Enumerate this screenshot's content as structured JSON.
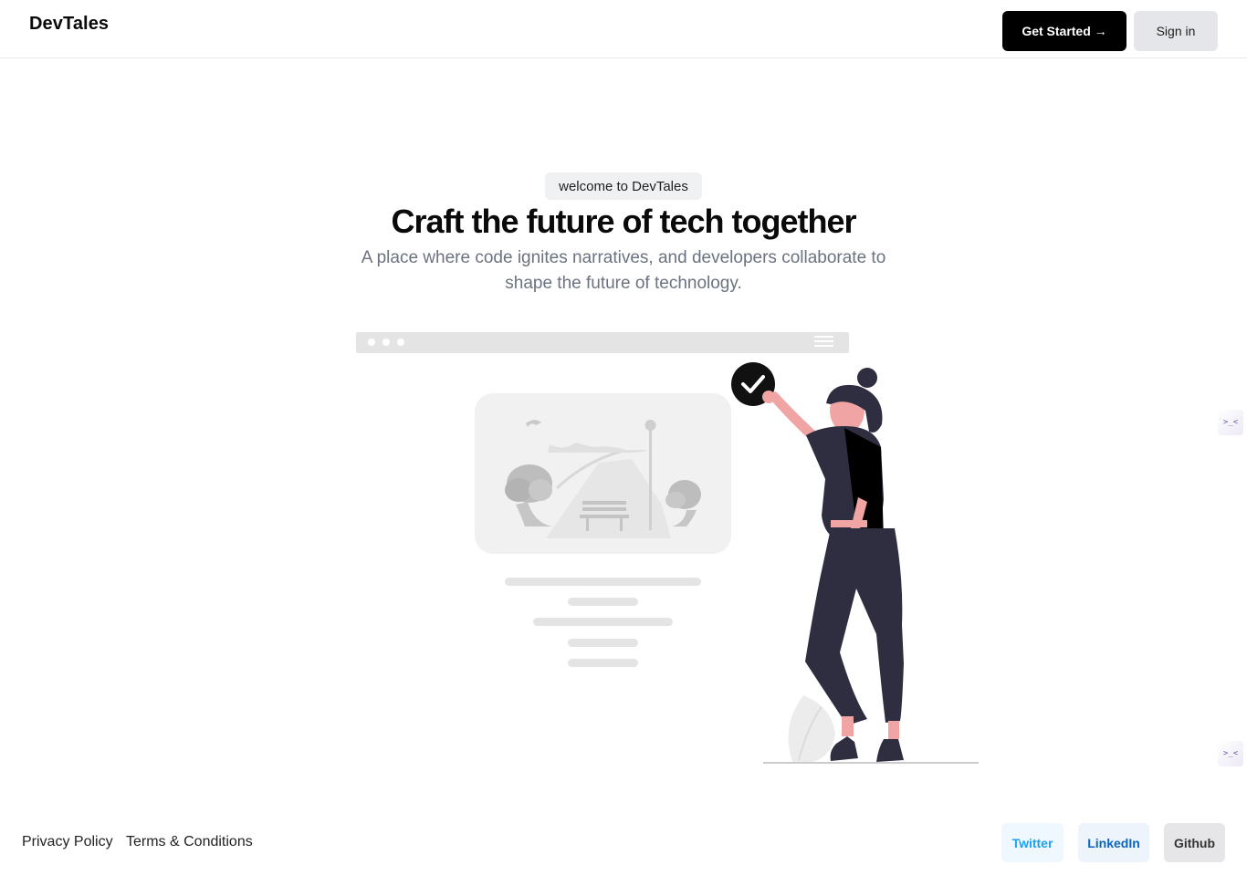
{
  "header": {
    "brand": "DevTales",
    "get_started_label": "Get Started →",
    "sign_in_label": "Sign in"
  },
  "hero": {
    "badge": "welcome to DevTales",
    "headline": "Craft the future of tech together",
    "subtitle": "A place where code ignites narratives, and developers collaborate to shape the future of technology."
  },
  "illustration": {
    "icons": [
      "browser-window-icon",
      "checkmark-icon",
      "woman-figure-icon",
      "park-scene-icon"
    ]
  },
  "side_widgets": {
    "glyph_top": ">_<",
    "glyph_bottom": ">_<"
  },
  "footer": {
    "privacy_label": "Privacy Policy",
    "terms_label": "Terms & Conditions",
    "social": {
      "twitter_label": "Twitter",
      "linkedin_label": "LinkedIn",
      "github_label": "Github"
    }
  },
  "colors": {
    "primary_button_bg": "#000000",
    "secondary_button_bg": "#e5e6e9",
    "twitter": "#1da1f2",
    "linkedin": "#0a66c2",
    "github": "#333333",
    "muted_text": "#6b7280"
  }
}
